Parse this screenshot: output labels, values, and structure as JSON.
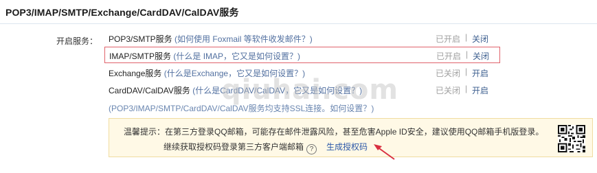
{
  "header": {
    "title": "POP3/IMAP/SMTP/Exchange/CardDAV/CalDAV服务"
  },
  "section": {
    "label": "开启服务："
  },
  "services": [
    {
      "name": "POP3/SMTP服务",
      "hint": "(如何使用 Foxmail 等软件收发邮件？)",
      "status": "已开启",
      "sep": "|",
      "action": "关闭"
    },
    {
      "name": "IMAP/SMTP服务",
      "hint": "(什么是 IMAP，它又是如何设置？)",
      "status": "已开启",
      "sep": "|",
      "action": "关闭"
    },
    {
      "name": "Exchange服务",
      "hint": "(什么是Exchange，它又是如何设置？)",
      "status": "已关闭",
      "sep": "|",
      "action": "开启"
    },
    {
      "name": "CardDAV/CalDAV服务",
      "hint": "(什么是CardDAV/CalDAV，它又是如何设置？)",
      "status": "已关闭",
      "sep": "|",
      "action": "开启"
    }
  ],
  "ssl_note": {
    "text": "(POP3/IMAP/SMTP/CardDAV/CalDAV服务均支持SSL连接。",
    "link": "如何设置？",
    "close": ")"
  },
  "tip": {
    "line1": "温馨提示：在第三方登录QQ邮箱，可能存在邮件泄露风险，甚至危害Apple ID安全，建议使用QQ邮箱手机版登录。",
    "line2": "继续获取授权码登录第三方客户端邮箱",
    "help": "?",
    "generate": "生成授权码"
  },
  "watermark": "qiuhai.com",
  "colors": {
    "highlight_border": "#e0626a",
    "tip_bg": "#fff9e6",
    "link": "#2b58a8",
    "arrow": "#d93040"
  }
}
